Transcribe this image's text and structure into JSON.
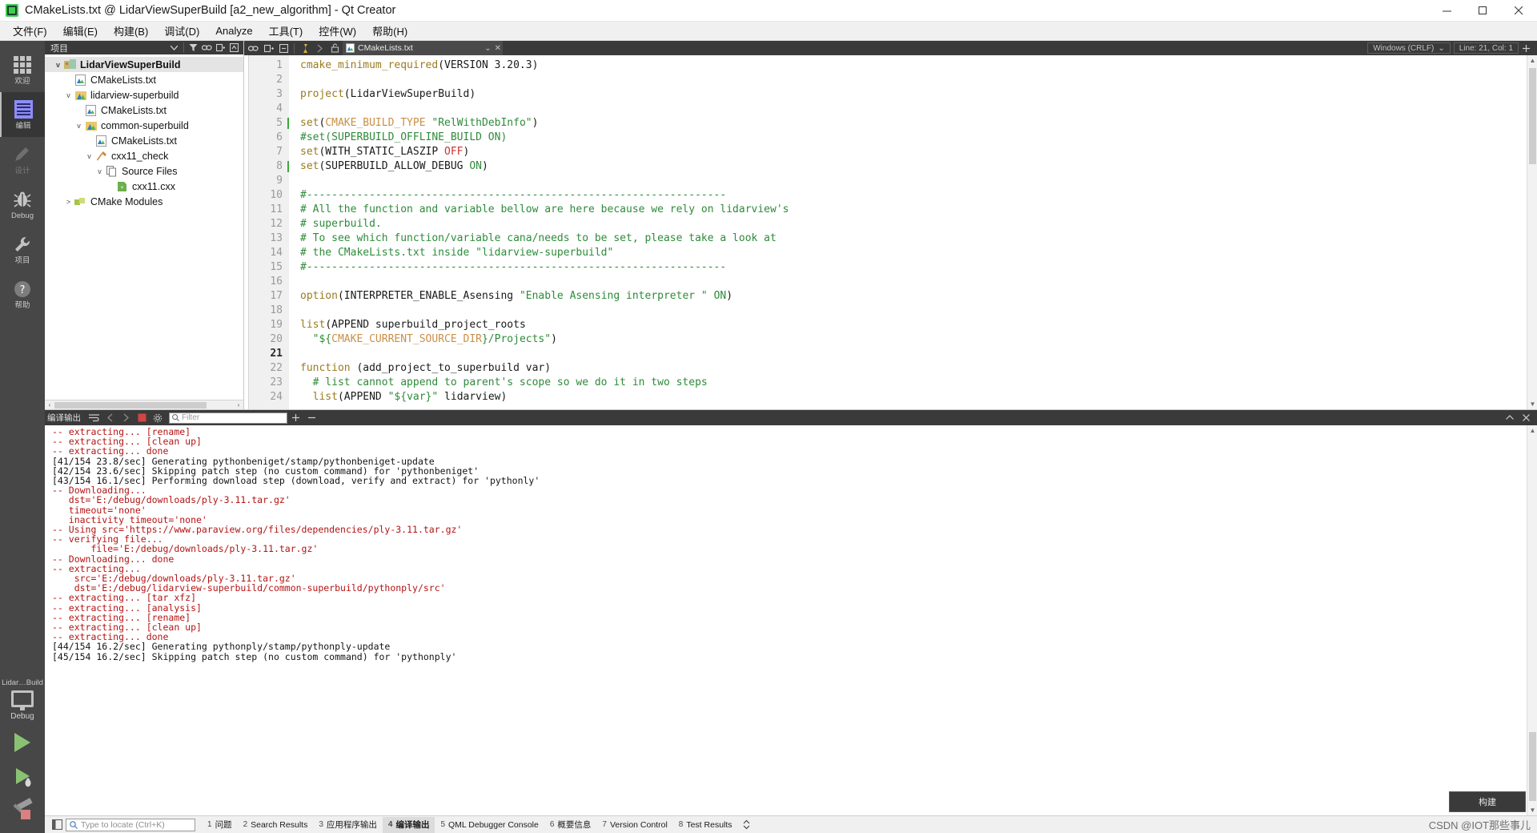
{
  "window": {
    "title": "CMakeLists.txt @ LidarViewSuperBuild [a2_new_algorithm] - Qt Creator",
    "minimize_label": "minimize-icon",
    "maximize_label": "maximize-icon",
    "close_label": "close-icon"
  },
  "menubar": {
    "items": [
      {
        "label": "文件(F)"
      },
      {
        "label": "编辑(E)"
      },
      {
        "label": "构建(B)"
      },
      {
        "label": "调试(D)"
      },
      {
        "label": "Analyze"
      },
      {
        "label": "工具(T)"
      },
      {
        "label": "控件(W)"
      },
      {
        "label": "帮助(H)"
      }
    ]
  },
  "activitybar": {
    "modes": [
      {
        "label": "欢迎",
        "icon": "grid-icon",
        "active": false
      },
      {
        "label": "编辑",
        "icon": "document-lines-icon",
        "active": true
      },
      {
        "label": "设计",
        "icon": "pencil-icon",
        "active": false
      },
      {
        "label": "Debug",
        "icon": "bug-icon",
        "active": false
      },
      {
        "label": "项目",
        "icon": "wrench-icon",
        "active": false
      },
      {
        "label": "帮助",
        "icon": "question-mark-icon",
        "active": false
      }
    ],
    "kit": {
      "name": "Lidar…Build",
      "build_config": "Debug",
      "run_label": "run-button",
      "debug_label": "run-debug-button",
      "build_label": "build-button"
    }
  },
  "project_panel": {
    "header_title": "项目",
    "header_icons": [
      "chevron-down-icon",
      "filter-icon",
      "link-icon",
      "split-icon",
      "sync-icon"
    ],
    "tree": [
      {
        "label": "LidarViewSuperBuild",
        "indent": 0,
        "arrow": "v",
        "icon": "project-icon",
        "selected": true
      },
      {
        "label": "CMakeLists.txt",
        "indent": 1,
        "arrow": "",
        "icon": "cmake-file-icon",
        "selected": false
      },
      {
        "label": "lidarview-superbuild",
        "indent": 1,
        "arrow": "v",
        "icon": "cmake-folder-icon",
        "selected": false
      },
      {
        "label": "CMakeLists.txt",
        "indent": 2,
        "arrow": "",
        "icon": "cmake-file-icon",
        "selected": false
      },
      {
        "label": "common-superbuild",
        "indent": 2,
        "arrow": "v",
        "icon": "cmake-folder-icon",
        "selected": false
      },
      {
        "label": "CMakeLists.txt",
        "indent": 3,
        "arrow": "",
        "icon": "cmake-file-icon",
        "selected": false
      },
      {
        "label": "cxx11_check",
        "indent": 3,
        "arrow": "v",
        "icon": "target-icon",
        "selected": false
      },
      {
        "label": "Source Files",
        "indent": 4,
        "arrow": "v",
        "icon": "files-icon",
        "selected": false
      },
      {
        "label": "cxx11.cxx",
        "indent": 5,
        "arrow": "",
        "icon": "cpp-file-icon",
        "selected": false
      },
      {
        "label": "CMake Modules",
        "indent": 1,
        "arrow": ">",
        "icon": "modules-icon",
        "selected": false
      }
    ]
  },
  "editor": {
    "toolbar": {
      "icons": [
        "link-icon",
        "split-icon",
        "close-split-icon",
        "bookmark-icon",
        "forward-icon",
        "lock-icon"
      ],
      "tab_name": "CMakeLists.txt",
      "tab_close": "close-icon",
      "line_ending": "Windows (CRLF)",
      "cursor_position": "Line: 21, Col: 1"
    },
    "lines": [
      {
        "n": 1,
        "mark": false,
        "cur": false,
        "tokens": [
          {
            "t": "cmake_minimum_required",
            "c": "k-fn"
          },
          {
            "t": "(VERSION 3.20.3)",
            "c": "k-plain"
          }
        ]
      },
      {
        "n": 2,
        "mark": false,
        "cur": false,
        "tokens": []
      },
      {
        "n": 3,
        "mark": false,
        "cur": false,
        "tokens": [
          {
            "t": "project",
            "c": "k-fn"
          },
          {
            "t": "(LidarViewSuperBuild)",
            "c": "k-plain"
          }
        ]
      },
      {
        "n": 4,
        "mark": false,
        "cur": false,
        "tokens": []
      },
      {
        "n": 5,
        "mark": true,
        "cur": false,
        "tokens": [
          {
            "t": "set",
            "c": "k-fn"
          },
          {
            "t": "(",
            "c": "k-plain"
          },
          {
            "t": "CMAKE_BUILD_TYPE",
            "c": "k-var"
          },
          {
            "t": " ",
            "c": "k-plain"
          },
          {
            "t": "\"RelWithDebInfo\"",
            "c": "k-str"
          },
          {
            "t": ")",
            "c": "k-plain"
          }
        ]
      },
      {
        "n": 6,
        "mark": false,
        "cur": false,
        "tokens": [
          {
            "t": "#set(SUPERBUILD_OFFLINE_BUILD ON)",
            "c": "k-cmt"
          }
        ]
      },
      {
        "n": 7,
        "mark": false,
        "cur": false,
        "tokens": [
          {
            "t": "set",
            "c": "k-fn"
          },
          {
            "t": "(WITH_STATIC_LASZIP ",
            "c": "k-plain"
          },
          {
            "t": "OFF",
            "c": "k-off"
          },
          {
            "t": ")",
            "c": "k-plain"
          }
        ]
      },
      {
        "n": 8,
        "mark": true,
        "cur": false,
        "tokens": [
          {
            "t": "set",
            "c": "k-fn"
          },
          {
            "t": "(SUPERBUILD_ALLOW_DEBUG ",
            "c": "k-plain"
          },
          {
            "t": "ON",
            "c": "k-on"
          },
          {
            "t": ")",
            "c": "k-plain"
          }
        ]
      },
      {
        "n": 9,
        "mark": false,
        "cur": false,
        "tokens": []
      },
      {
        "n": 10,
        "mark": false,
        "cur": false,
        "tokens": [
          {
            "t": "#-------------------------------------------------------------------",
            "c": "k-cmt"
          }
        ]
      },
      {
        "n": 11,
        "mark": false,
        "cur": false,
        "tokens": [
          {
            "t": "# All the function and variable bellow are here because we rely on lidarview's",
            "c": "k-cmt"
          }
        ]
      },
      {
        "n": 12,
        "mark": false,
        "cur": false,
        "tokens": [
          {
            "t": "# superbuild.",
            "c": "k-cmt"
          }
        ]
      },
      {
        "n": 13,
        "mark": false,
        "cur": false,
        "tokens": [
          {
            "t": "# To see which function/variable cana/needs to be set, please take a look at",
            "c": "k-cmt"
          }
        ]
      },
      {
        "n": 14,
        "mark": false,
        "cur": false,
        "tokens": [
          {
            "t": "# the CMakeLists.txt inside \"lidarview-superbuild\"",
            "c": "k-cmt"
          }
        ]
      },
      {
        "n": 15,
        "mark": false,
        "cur": false,
        "tokens": [
          {
            "t": "#-------------------------------------------------------------------",
            "c": "k-cmt"
          }
        ]
      },
      {
        "n": 16,
        "mark": false,
        "cur": false,
        "tokens": []
      },
      {
        "n": 17,
        "mark": false,
        "cur": false,
        "tokens": [
          {
            "t": "option",
            "c": "k-fn"
          },
          {
            "t": "(INTERPRETER_ENABLE_Asensing ",
            "c": "k-plain"
          },
          {
            "t": "\"Enable Asensing interpreter \"",
            "c": "k-str"
          },
          {
            "t": " ",
            "c": "k-plain"
          },
          {
            "t": "ON",
            "c": "k-on"
          },
          {
            "t": ")",
            "c": "k-plain"
          }
        ]
      },
      {
        "n": 18,
        "mark": false,
        "cur": false,
        "tokens": []
      },
      {
        "n": 19,
        "mark": false,
        "cur": false,
        "tokens": [
          {
            "t": "list",
            "c": "k-fn"
          },
          {
            "t": "(APPEND superbuild_project_roots",
            "c": "k-plain"
          }
        ]
      },
      {
        "n": 20,
        "mark": false,
        "cur": false,
        "tokens": [
          {
            "t": "  ",
            "c": "k-plain"
          },
          {
            "t": "\"${",
            "c": "k-str"
          },
          {
            "t": "CMAKE_CURRENT_SOURCE_DIR",
            "c": "k-var"
          },
          {
            "t": "}/Projects\"",
            "c": "k-str"
          },
          {
            "t": ")",
            "c": "k-plain"
          }
        ]
      },
      {
        "n": 21,
        "mark": false,
        "cur": true,
        "tokens": []
      },
      {
        "n": 22,
        "mark": false,
        "cur": false,
        "tokens": [
          {
            "t": "function",
            "c": "k-fn"
          },
          {
            "t": " (add_project_to_superbuild var)",
            "c": "k-plain"
          }
        ]
      },
      {
        "n": 23,
        "mark": false,
        "cur": false,
        "tokens": [
          {
            "t": "  ",
            "c": "k-plain"
          },
          {
            "t": "# list cannot append to parent's scope so we do it in two steps",
            "c": "k-cmt"
          }
        ]
      },
      {
        "n": 24,
        "mark": false,
        "cur": false,
        "tokens": [
          {
            "t": "  ",
            "c": "k-plain"
          },
          {
            "t": "list",
            "c": "k-fn"
          },
          {
            "t": "(APPEND ",
            "c": "k-plain"
          },
          {
            "t": "\"${var}\"",
            "c": "k-str"
          },
          {
            "t": " lidarview)",
            "c": "k-plain"
          }
        ]
      }
    ]
  },
  "output_pane": {
    "title": "编译输出",
    "icons": [
      "word-wrap-icon",
      "prev-icon",
      "next-icon",
      "stop-icon",
      "settings-icon"
    ],
    "filter_placeholder": "Filter",
    "zoom_in": "plus-icon",
    "zoom_out": "minus-icon",
    "maximize": "chevron-up-icon",
    "close": "close-icon",
    "build_tooltip": "构建",
    "lines": [
      {
        "text": "-- extracting... [rename]",
        "color": "red"
      },
      {
        "text": "-- extracting... [clean up]",
        "color": "red"
      },
      {
        "text": "-- extracting... done",
        "color": "red"
      },
      {
        "text": "[41/154 23.8/sec] Generating pythonbeniget/stamp/pythonbeniget-update",
        "color": "black"
      },
      {
        "text": "[42/154 23.6/sec] Skipping patch step (no custom command) for 'pythonbeniget'",
        "color": "black"
      },
      {
        "text": "[43/154 16.1/sec] Performing download step (download, verify and extract) for 'pythonly'",
        "color": "black"
      },
      {
        "text": "-- Downloading...",
        "color": "red"
      },
      {
        "text": "   dst='E:/debug/downloads/ply-3.11.tar.gz'",
        "color": "red"
      },
      {
        "text": "   timeout='none'",
        "color": "red"
      },
      {
        "text": "   inactivity timeout='none'",
        "color": "red"
      },
      {
        "text": "-- Using src='https://www.paraview.org/files/dependencies/ply-3.11.tar.gz'",
        "color": "red"
      },
      {
        "text": "-- verifying file...",
        "color": "red"
      },
      {
        "text": "       file='E:/debug/downloads/ply-3.11.tar.gz'",
        "color": "red"
      },
      {
        "text": "-- Downloading... done",
        "color": "red"
      },
      {
        "text": "-- extracting...",
        "color": "red"
      },
      {
        "text": "    src='E:/debug/downloads/ply-3.11.tar.gz'",
        "color": "red"
      },
      {
        "text": "    dst='E:/debug/lidarview-superbuild/common-superbuild/pythonply/src'",
        "color": "red"
      },
      {
        "text": "-- extracting... [tar xfz]",
        "color": "red"
      },
      {
        "text": "-- extracting... [analysis]",
        "color": "red"
      },
      {
        "text": "-- extracting... [rename]",
        "color": "red"
      },
      {
        "text": "-- extracting... [clean up]",
        "color": "red"
      },
      {
        "text": "-- extracting... done",
        "color": "red"
      },
      {
        "text": "[44/154 16.2/sec] Generating pythonply/stamp/pythonply-update",
        "color": "black"
      },
      {
        "text": "[45/154 16.2/sec] Skipping patch step (no custom command) for 'pythonply'",
        "color": "black"
      }
    ]
  },
  "statusbar": {
    "locator_placeholder": "Type to locate (Ctrl+K)",
    "tabs": [
      {
        "num": "1",
        "label": "问题",
        "active": false
      },
      {
        "num": "2",
        "label": "Search Results",
        "active": false
      },
      {
        "num": "3",
        "label": "应用程序输出",
        "active": false
      },
      {
        "num": "4",
        "label": "编译输出",
        "active": true
      },
      {
        "num": "5",
        "label": "QML Debugger Console",
        "active": false
      },
      {
        "num": "6",
        "label": "概要信息",
        "active": false
      },
      {
        "num": "7",
        "label": "Version Control",
        "active": false
      },
      {
        "num": "8",
        "label": "Test Results",
        "active": false
      }
    ],
    "watermark": "CSDN @IOT那些事儿"
  },
  "colors": {
    "accent_green": "#41cd52",
    "panel_dark": "#3a3a3a",
    "activity_bar": "#474747",
    "log_red": "#b31414",
    "syntax_function": "#9b7b1e",
    "syntax_string": "#2e8b3a",
    "syntax_variable": "#c98f46",
    "syntax_off": "#cc3333"
  }
}
